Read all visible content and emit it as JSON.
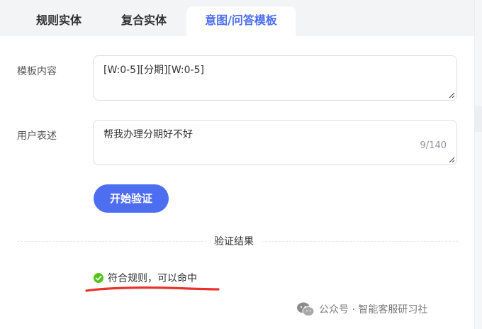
{
  "tabs": {
    "rule_entity": "规则实体",
    "composite_entity": "复合实体",
    "intent_template": "意图/问答模板"
  },
  "form": {
    "template_label": "模板内容",
    "template_value": "[W:0-5][分期][W:0-5]",
    "utterance_label": "用户表述",
    "utterance_value": "帮我办理分期好不好",
    "utterance_counter": "9/140"
  },
  "actions": {
    "verify_label": "开始验证"
  },
  "result": {
    "title": "验证结果",
    "message": "符合规则，可以命中"
  },
  "watermark": {
    "text": "公众号 · 智能客服研习社"
  },
  "colors": {
    "accent": "#4e6ef2",
    "success": "#52c41a",
    "annotation": "#e8322d"
  }
}
